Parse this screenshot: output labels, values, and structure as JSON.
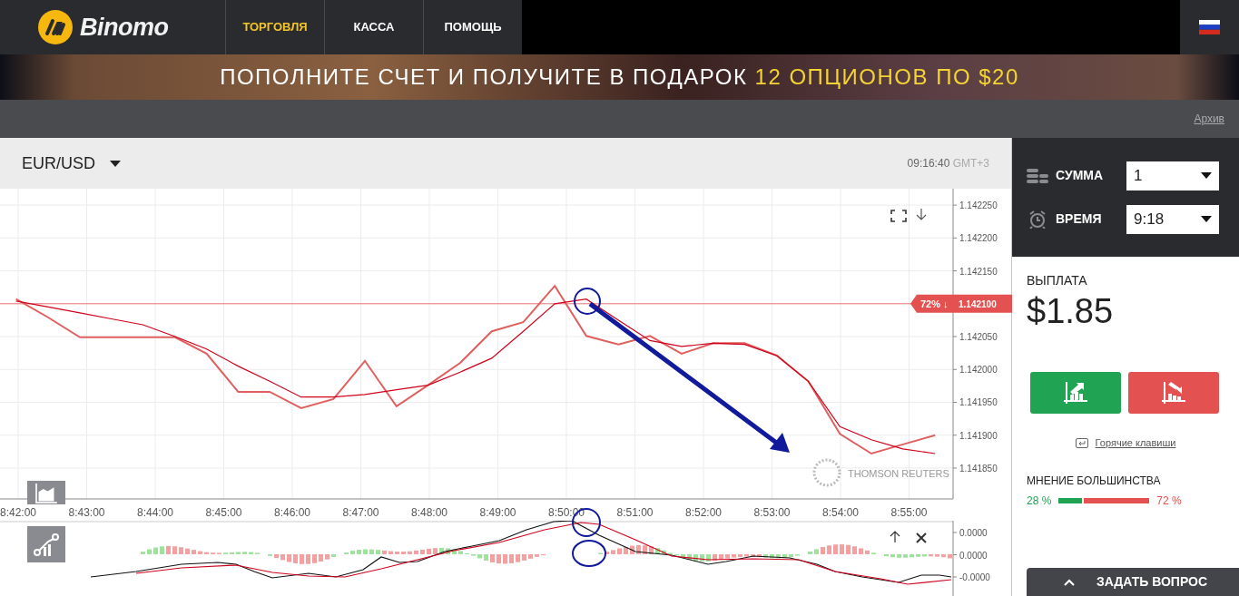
{
  "header": {
    "logo": "Binomo",
    "nav": [
      {
        "label": "ТОРГОВЛЯ",
        "selected": true
      },
      {
        "label": "КАССА",
        "selected": false
      },
      {
        "label": "ПОМОЩЬ",
        "selected": false
      }
    ]
  },
  "banner": {
    "text": "ПОПОЛНИТЕ СЧЕТ И ПОЛУЧИТЕ В ПОДАРОК",
    "highlight": "12 ОПЦИОНОВ ПО $20"
  },
  "subbar": {
    "link": "Архив"
  },
  "chart_header": {
    "asset": "EUR/USD",
    "time": "09:16:40",
    "timezone": "GMT+3"
  },
  "price_chart": {
    "price_tag": {
      "percent": "72%",
      "direction": "↓"
    },
    "provider": "THOMSON REUTERS",
    "chart_data": {
      "type": "line",
      "grid": true,
      "x": [
        521.97,
        522.44,
        522.9,
        523.36,
        523.82,
        524.29,
        524.75,
        525.21,
        525.67,
        526.13,
        526.6,
        527.06,
        527.52,
        527.98,
        528.45,
        528.91,
        529.37,
        529.83,
        530.29,
        530.76,
        531.22,
        531.68,
        532.14,
        532.6,
        533.07,
        533.53,
        533.99,
        534.45,
        534.91,
        535.38
      ],
      "series": [
        {
          "color": "#e06060",
          "values": [
            1.142107,
            1.142079,
            1.142049,
            1.142049,
            1.142049,
            1.142049,
            1.142024,
            1.141966,
            1.141966,
            1.141941,
            1.141955,
            1.142013,
            1.141944,
            1.141976,
            1.14201,
            1.142058,
            1.142072,
            1.142127,
            1.142051,
            1.142038,
            1.142051,
            1.142024,
            1.14204,
            1.14204,
            1.142021,
            1.141982,
            1.141902,
            1.141872,
            1.141886,
            1.1419
          ]
        },
        {
          "color": "#d0021b",
          "values": [
            1.142104,
            1.142095,
            1.142086,
            1.142077,
            1.142068,
            1.14205,
            1.142031,
            1.142005,
            1.141982,
            1.141958,
            1.141958,
            1.141962,
            1.141969,
            1.141976,
            1.141996,
            1.142017,
            1.142058,
            1.1421,
            1.142107,
            1.142075,
            1.142044,
            1.142035,
            1.14204,
            1.142038,
            1.142021,
            1.141982,
            1.141913,
            1.141893,
            1.141879,
            1.141872
          ]
        }
      ],
      "ref_lines": [
        {
          "axis": "y",
          "value": 1.1421,
          "label": "1.142100",
          "color": "#e57373"
        }
      ],
      "xlim": [
        521.735,
        535.642
      ],
      "ylim": [
        1.141803,
        1.142275
      ],
      "yticks": [
        {
          "value": 1.14225,
          "label": "1.142250"
        },
        {
          "value": 1.1422,
          "label": "1.142200"
        },
        {
          "value": 1.14215,
          "label": "1.142150"
        },
        {
          "value": 1.14205,
          "label": "1.142050"
        },
        {
          "value": 1.142,
          "label": "1.142000"
        },
        {
          "value": 1.14195,
          "label": "1.141950"
        },
        {
          "value": 1.1419,
          "label": "1.141900"
        },
        {
          "value": 1.14185,
          "label": "1.141850"
        }
      ],
      "xticks": [
        {
          "value": 522,
          "label": "8:42:00"
        },
        {
          "value": 523,
          "label": "8:43:00"
        },
        {
          "value": 524,
          "label": "8:44:00"
        },
        {
          "value": 525,
          "label": "8:45:00"
        },
        {
          "value": 526,
          "label": "8:46:00"
        },
        {
          "value": 527,
          "label": "8:47:00"
        },
        {
          "value": 528,
          "label": "8:48:00"
        },
        {
          "value": 529,
          "label": "8:49:00"
        },
        {
          "value": 530,
          "label": "8:50:00"
        },
        {
          "value": 531,
          "label": "8:51:00"
        },
        {
          "value": 532,
          "label": "8:52:00"
        },
        {
          "value": 533,
          "label": "8:53:00"
        },
        {
          "value": 534,
          "label": "8:54:00"
        },
        {
          "value": 535,
          "label": "8:55:00"
        }
      ]
    }
  },
  "indicator": {
    "yticks": [
      "0.0000",
      "0.0000",
      "-0.0000"
    ]
  },
  "trade_panel": {
    "amount_label": "СУММА",
    "amount": "1",
    "time_label": "ВРЕМЯ",
    "time": "9:18",
    "payout_label": "ВЫПЛАТА",
    "payout": "$1.85",
    "hotkeys": "Горячие клавиши",
    "majority_label": "МНЕНИЕ БОЛЬШИНСТВА",
    "majority": {
      "up": "28 %",
      "down": "72 %",
      "level": 0.28
    },
    "ask_button": "ЗАДАТЬ ВОПРОС"
  }
}
